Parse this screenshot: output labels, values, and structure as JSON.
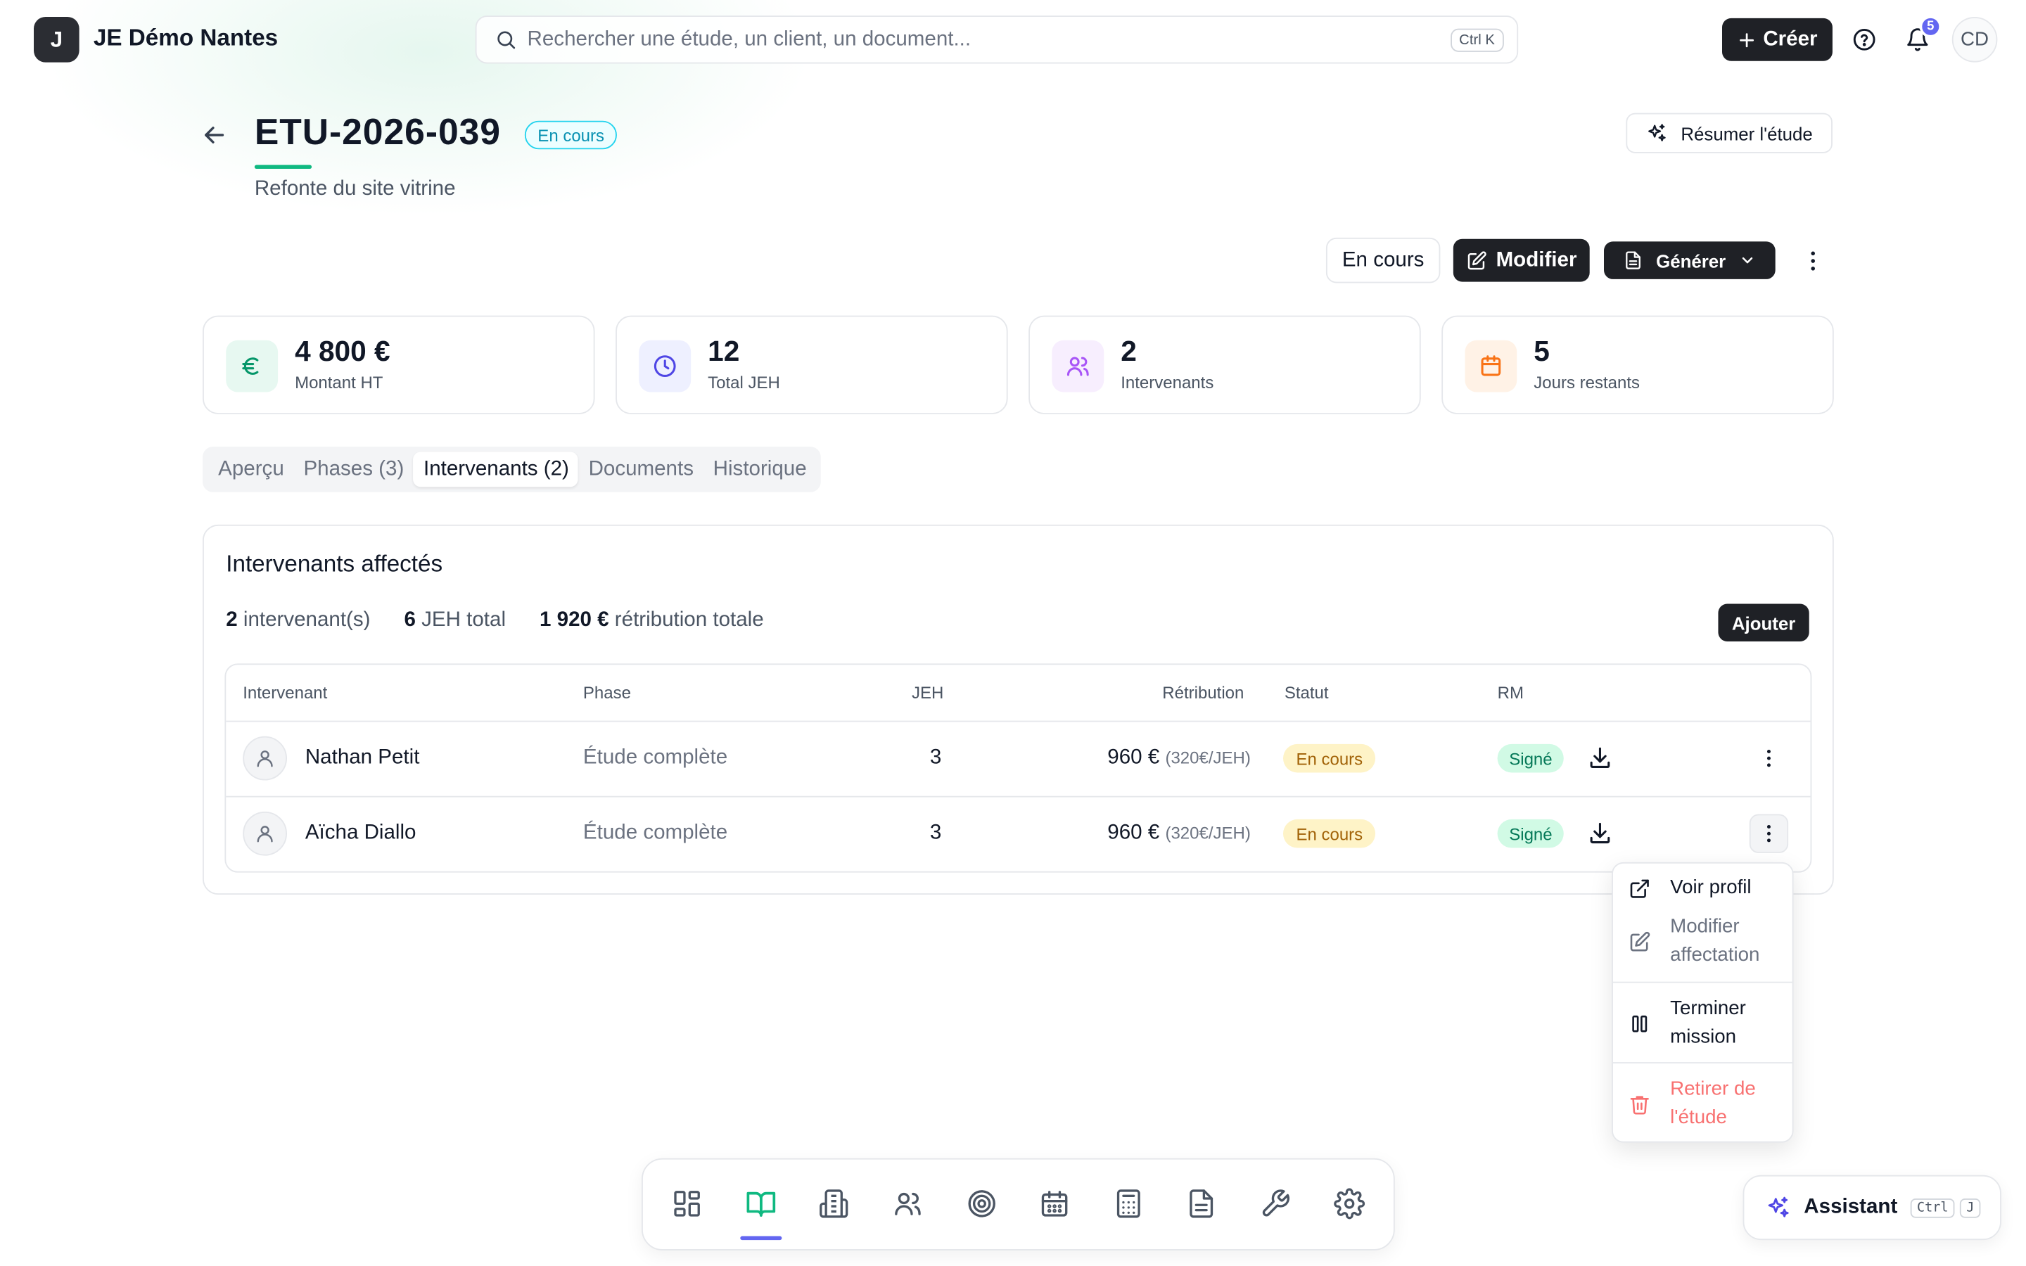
{
  "org": {
    "initial": "J",
    "name": "JE Démo Nantes"
  },
  "search": {
    "placeholder": "Rechercher une étude, un client, un document...",
    "shortcut": "Ctrl K"
  },
  "topbar": {
    "create_label": "Créer",
    "notifications_count": "5",
    "user_initials": "CD"
  },
  "study": {
    "code": "ETU-2026-039",
    "status": "En cours",
    "subtitle": "Refonte du site vitrine",
    "summarize_label": "Résumer l'étude",
    "status_button": "En cours",
    "modify_label": "Modifier",
    "generate_label": "Générer"
  },
  "stats": [
    {
      "value": "4 800 €",
      "label": "Montant HT",
      "icon": "euro-icon",
      "color": "#059669",
      "bg": "#e7f8f1"
    },
    {
      "value": "12",
      "label": "Total JEH",
      "icon": "clock-icon",
      "color": "#4f46e5",
      "bg": "#eef0ff"
    },
    {
      "value": "2",
      "label": "Intervenants",
      "icon": "users-icon",
      "color": "#a855f7",
      "bg": "#f7eefe"
    },
    {
      "value": "5",
      "label": "Jours restants",
      "icon": "calendar-icon",
      "color": "#f97316",
      "bg": "#fff2e6"
    }
  ],
  "tabs": [
    {
      "label": "Aperçu",
      "active": false
    },
    {
      "label": "Phases (3)",
      "active": false
    },
    {
      "label": "Intervenants (2)",
      "active": true
    },
    {
      "label": "Documents",
      "active": false
    },
    {
      "label": "Historique",
      "active": false
    }
  ],
  "assignments": {
    "title": "Intervenants affectés",
    "summary": [
      {
        "value": "2",
        "text": "intervenant(s)"
      },
      {
        "value": "6",
        "text": "JEH total"
      },
      {
        "value": "1 920 €",
        "text": "rétribution totale"
      }
    ],
    "add_label": "Ajouter",
    "columns": [
      "Intervenant",
      "Phase",
      "JEH",
      "Rétribution",
      "Statut",
      "RM"
    ],
    "rows": [
      {
        "name": "Nathan Petit",
        "phase": "Étude complète",
        "jeh": "3",
        "amount": "960 €",
        "rate": "(320€/JEH)",
        "status": "En cours",
        "rm": "Signé"
      },
      {
        "name": "Aïcha Diallo",
        "phase": "Étude complète",
        "jeh": "3",
        "amount": "960 €",
        "rate": "(320€/JEH)",
        "status": "En cours",
        "rm": "Signé"
      }
    ]
  },
  "row_menu": {
    "view_profile": "Voir profil",
    "edit_line1": "Modifier",
    "edit_line2": "affectation",
    "end_line1": "Terminer",
    "end_line2": "mission",
    "remove_line1": "Retirer de",
    "remove_line2": "l'étude"
  },
  "dock": {
    "items": [
      "dashboard-icon",
      "book-icon",
      "building-icon",
      "users-icon",
      "target-icon",
      "calendar-icon",
      "calculator-icon",
      "document-icon",
      "wrench-icon",
      "settings-icon"
    ],
    "active_index": 1,
    "active_color": "#10b981"
  },
  "assistant": {
    "label": "Assistant",
    "key1": "Ctrl",
    "key2": "J"
  }
}
